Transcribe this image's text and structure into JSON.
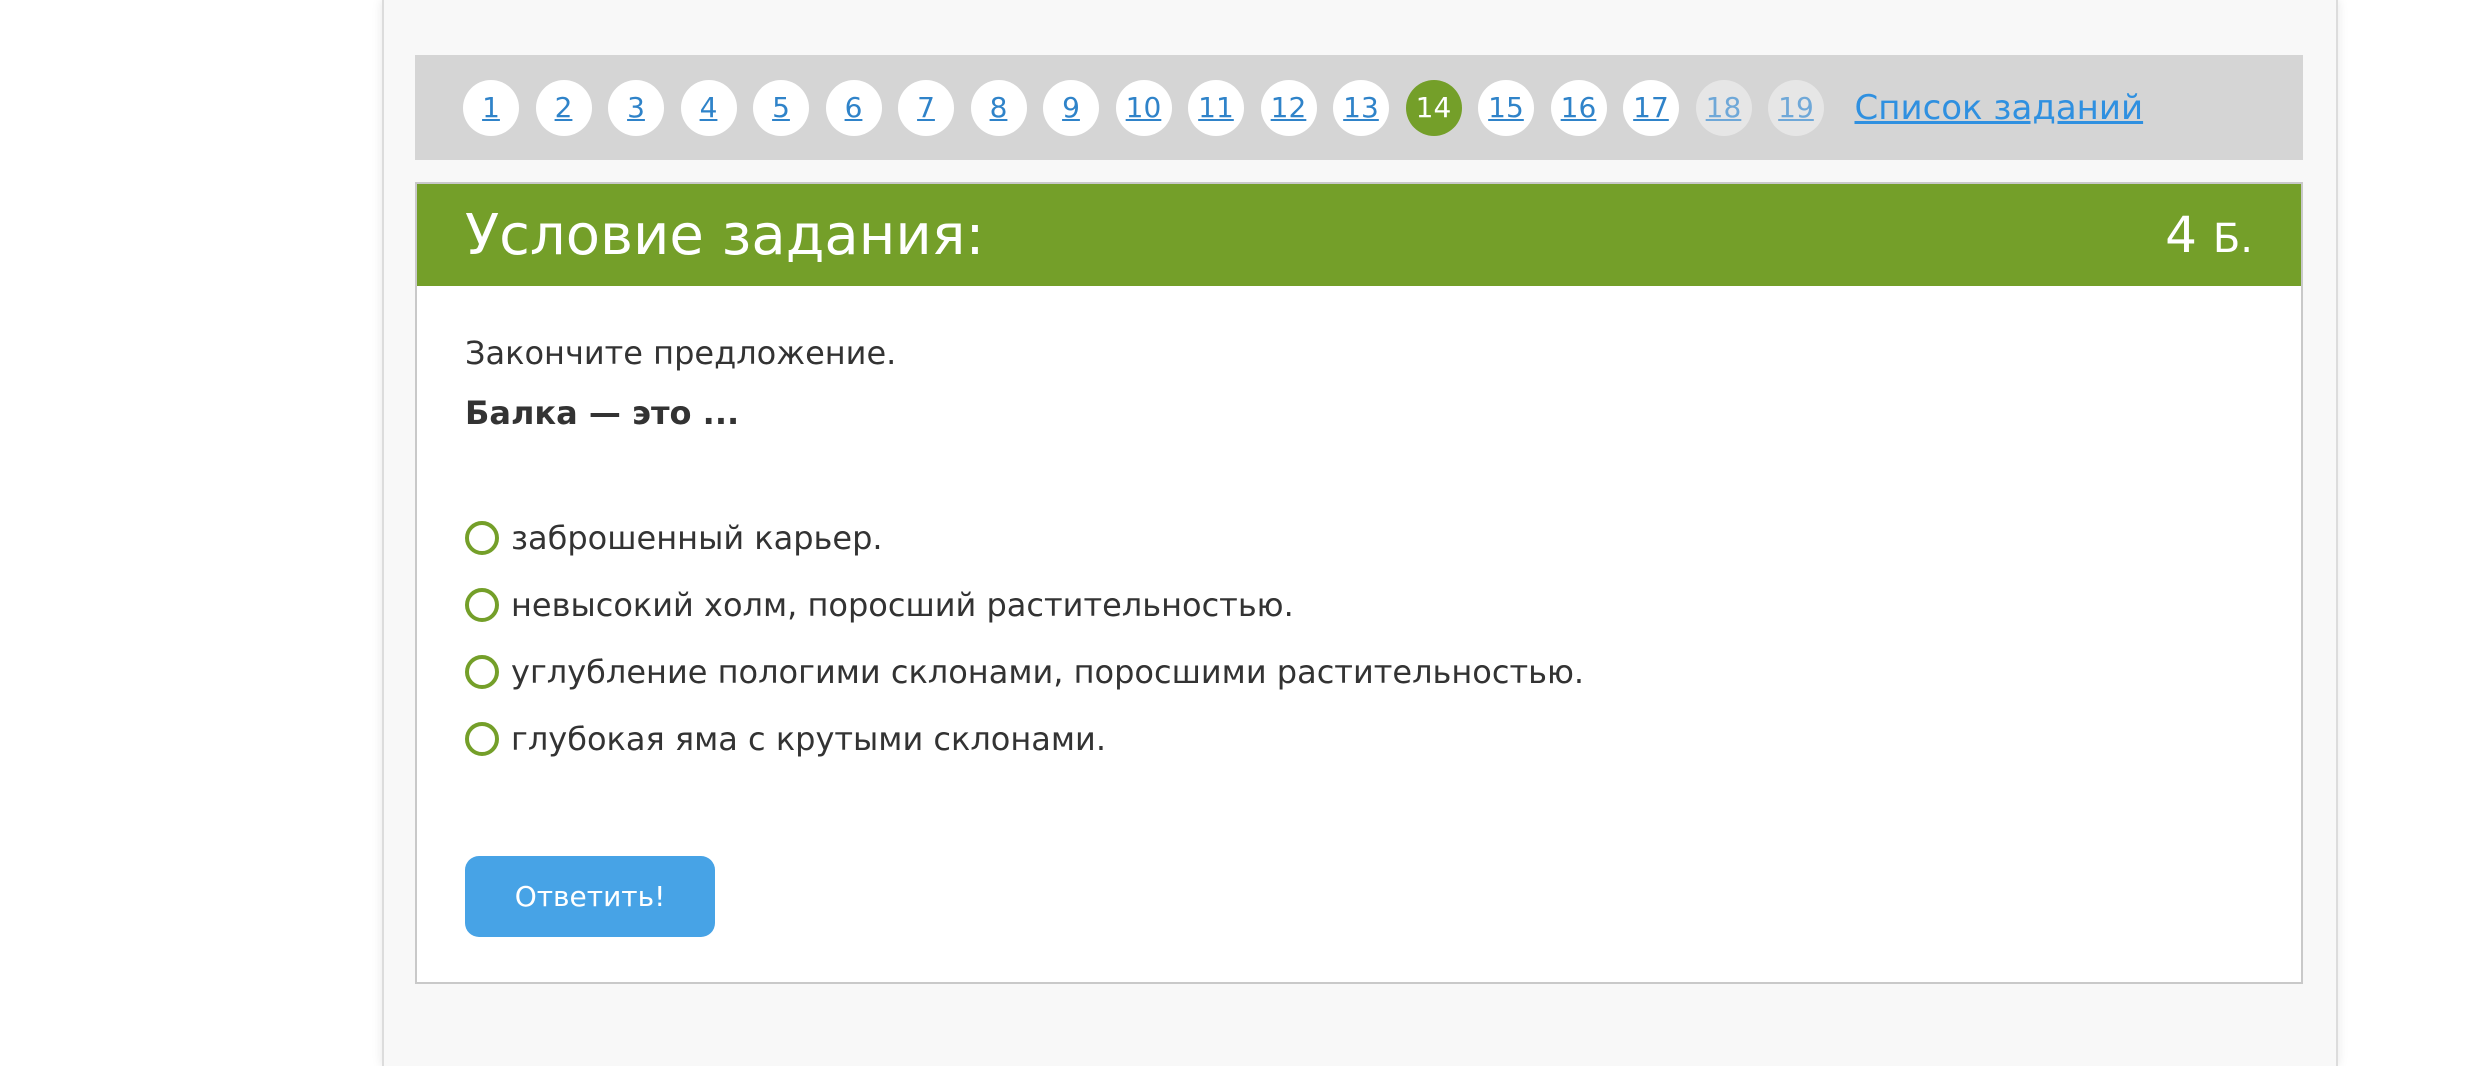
{
  "nav": {
    "items": [
      {
        "label": "1",
        "state": "normal"
      },
      {
        "label": "2",
        "state": "normal"
      },
      {
        "label": "3",
        "state": "normal"
      },
      {
        "label": "4",
        "state": "normal"
      },
      {
        "label": "5",
        "state": "normal"
      },
      {
        "label": "6",
        "state": "normal"
      },
      {
        "label": "7",
        "state": "normal"
      },
      {
        "label": "8",
        "state": "normal"
      },
      {
        "label": "9",
        "state": "normal"
      },
      {
        "label": "10",
        "state": "normal"
      },
      {
        "label": "11",
        "state": "normal"
      },
      {
        "label": "12",
        "state": "normal"
      },
      {
        "label": "13",
        "state": "normal"
      },
      {
        "label": "14",
        "state": "active"
      },
      {
        "label": "15",
        "state": "normal"
      },
      {
        "label": "16",
        "state": "normal"
      },
      {
        "label": "17",
        "state": "normal"
      },
      {
        "label": "18",
        "state": "disabled"
      },
      {
        "label": "19",
        "state": "disabled"
      }
    ],
    "list_link": "Список заданий"
  },
  "task": {
    "title": "Условие задания:",
    "points_value": "4",
    "points_unit": "Б.",
    "instruction": "Закончите предложение.",
    "question": "Балка — это ...",
    "options": [
      "заброшенный карьер.",
      "невысокий холм, поросший растительностью.",
      "углубление пологими склонами, поросшими растительностью.",
      "глубокая яма с крутыми склонами."
    ],
    "submit_label": "Ответить!"
  },
  "colors": {
    "accent_green": "#749f29",
    "link_blue": "#2f90e0",
    "button_blue": "#47a3e6"
  }
}
